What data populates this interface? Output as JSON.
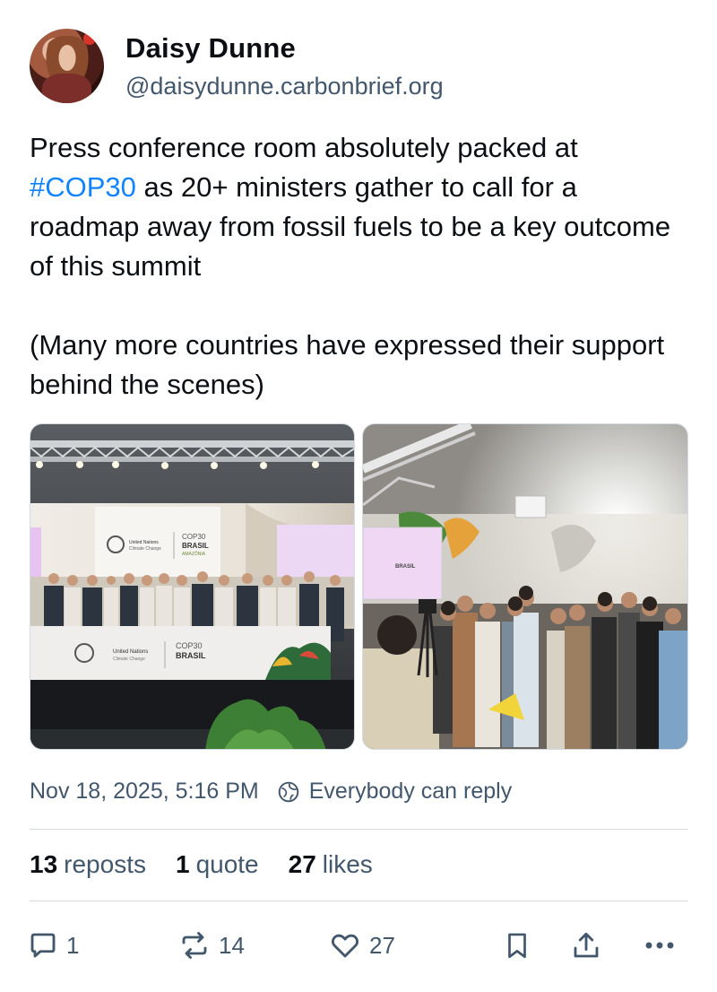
{
  "author": {
    "display_name": "Daisy Dunne",
    "handle": "@daisydunne.carbonbrief.org"
  },
  "post": {
    "text_before": "Press conference room absolutely packed at\n",
    "hashtag": "#COP30",
    "text_after": " as 20+ ministers gather to call for a roadmap away from fossil fuels to be a key outcome of this summit\n\n(Many more countries have expressed their support behind the scenes)",
    "images": [
      {
        "banner_un": "United Nations",
        "banner_un_sub": "Climate Change",
        "banner_cop": "COP30",
        "banner_brasil": "BRASIL",
        "banner_amazonia": "AMAZÔNIA"
      },
      {
        "screen_brand": "BRASIL"
      }
    ]
  },
  "meta": {
    "timestamp": "Nov 18, 2025, 5:16 PM",
    "reply_setting": "Everybody can reply"
  },
  "stats": {
    "reposts_count": "13",
    "reposts_label": "reposts",
    "quotes_count": "1",
    "quotes_label": "quote",
    "likes_count": "27",
    "likes_label": "likes"
  },
  "actions": {
    "reply_count": "1",
    "repost_count": "14",
    "like_count": "27"
  },
  "colors": {
    "text": "#0b0f14",
    "muted": "#42576c",
    "link": "#1083fe",
    "divider": "#d4dbe2"
  }
}
